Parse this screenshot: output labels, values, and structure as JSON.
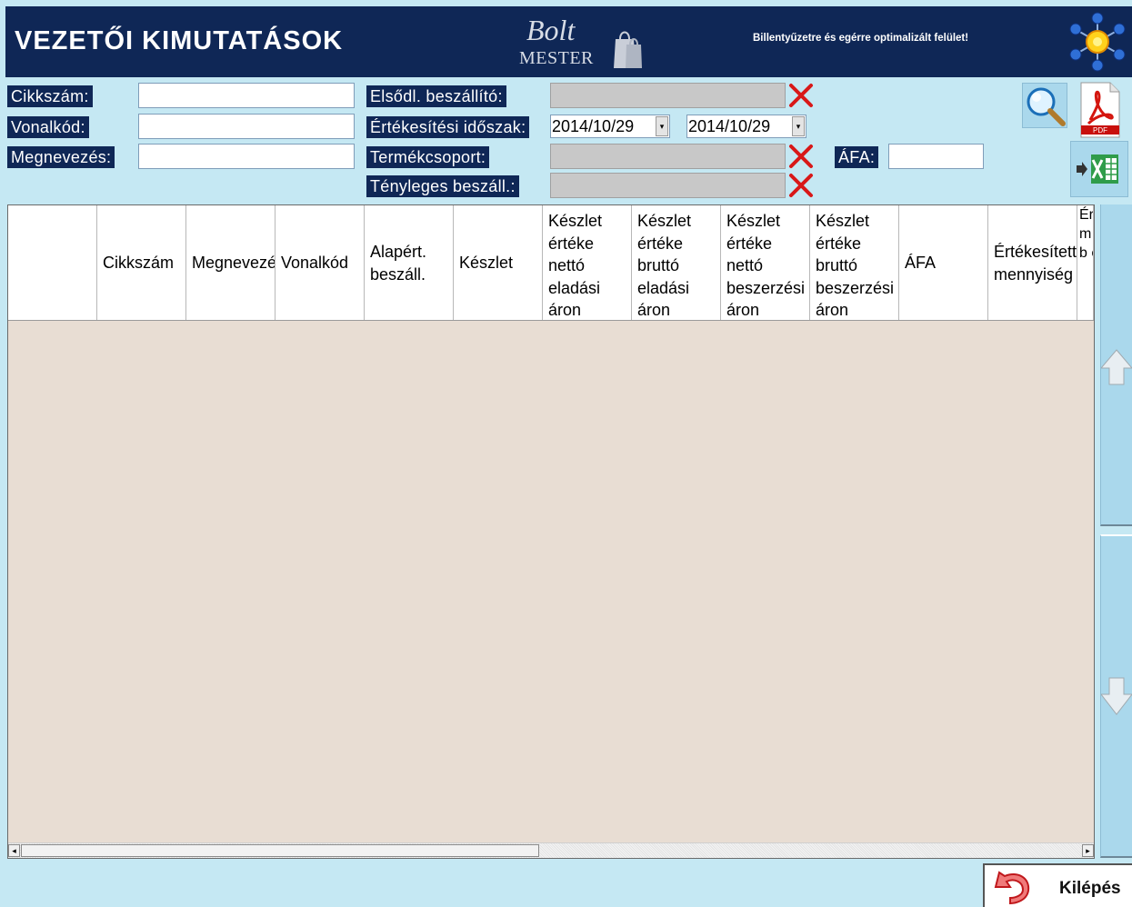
{
  "header": {
    "title": "VEZETŐI KIMUTATÁSOK",
    "logo_bolt": "Bolt",
    "logo_mester": "MESTER",
    "tagline": "Billentyűzetre és egérre optimalizált felület!"
  },
  "filters": {
    "cikkszam_label": "Cikkszám:",
    "cikkszam_value": "",
    "vonalkod_label": "Vonalkód:",
    "vonalkod_value": "",
    "megnevezes_label": "Megnevezés:",
    "megnevezes_value": "",
    "elsodl_beszallito_label": "Elsődl. beszállító:",
    "ertekesitesi_idoszak_label": "Értékesítési időszak:",
    "date_from": "2014/10/29",
    "date_to": "2014/10/29",
    "termekcsoport_label": "Termékcsoport:",
    "tenyleges_beszall_label": "Tényleges beszáll.:",
    "afa_label": "ÁFA:",
    "afa_value": ""
  },
  "actions": {
    "pdf_label": "PDF",
    "exit_label": "Kilépés"
  },
  "table": {
    "columns": [
      "",
      "Cikkszám",
      "Megnevezés",
      "Vonalkód",
      "Alapért. beszáll.",
      "Készlet",
      "Készlet értéke nettó eladási áron",
      "Készlet értéke bruttó eladási áron",
      "Készlet értéke nettó beszerzési áron",
      "Készlet értéke bruttó beszerzési áron",
      "ÁFA",
      "Értékesített mennyiség",
      "Érték m n b é"
    ],
    "rows": []
  },
  "colors": {
    "header_bg": "#0f2756",
    "page_bg": "#c5e8f3",
    "button_bg": "#aad8ec",
    "table_bg": "#e8ddd3"
  },
  "icons": [
    "gear-network-icon",
    "search-icon",
    "pdf-icon",
    "excel-export-icon",
    "clear-x-icon",
    "arrow-up-icon",
    "arrow-down-icon",
    "undo-exit-icon"
  ]
}
